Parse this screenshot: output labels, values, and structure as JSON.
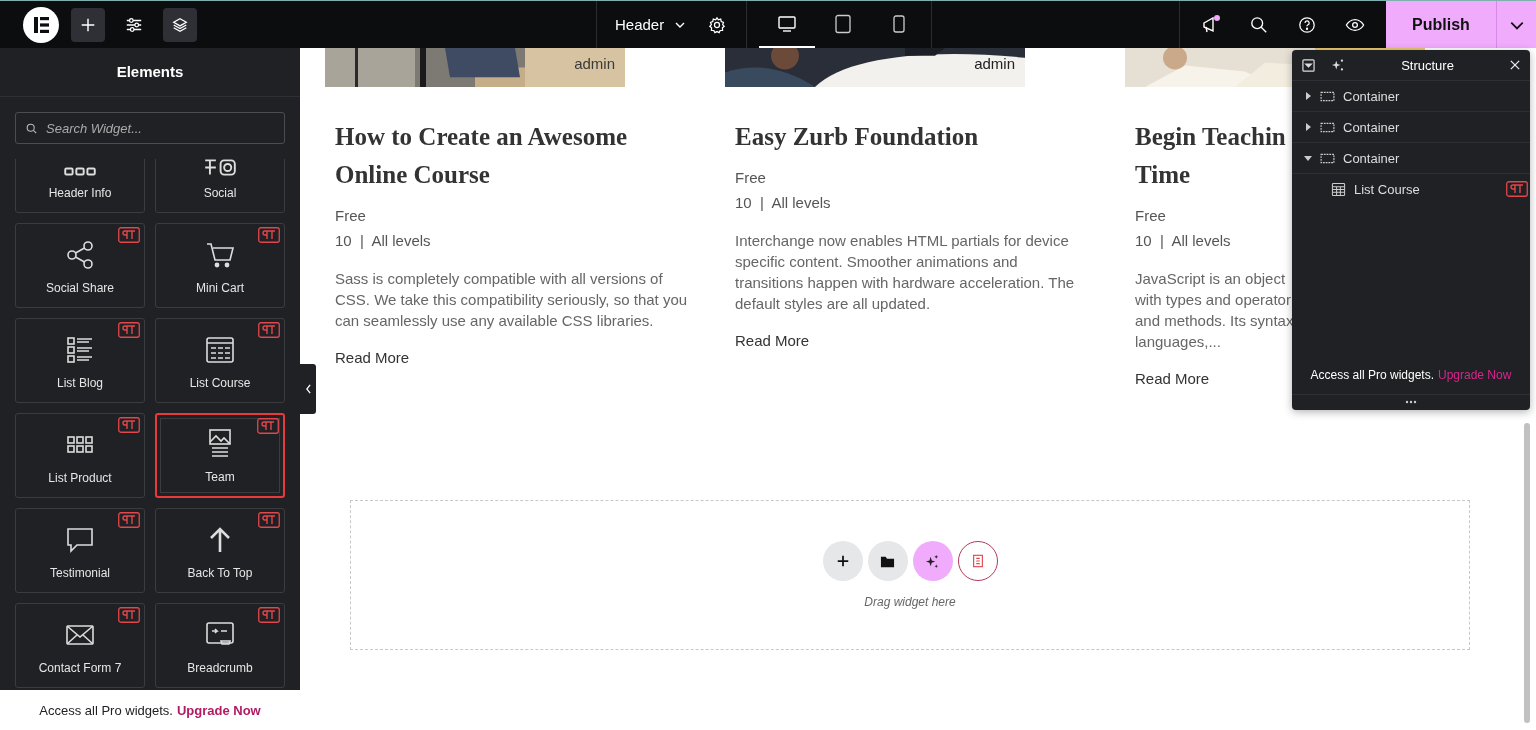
{
  "topbar": {
    "page_menu": "Header",
    "devices": [
      {
        "kind": "desktop",
        "selected": true
      },
      {
        "kind": "tablet",
        "selected": false
      },
      {
        "kind": "mobile",
        "selected": false
      }
    ],
    "notification": true,
    "publish": "Publish"
  },
  "panel": {
    "title": "Elements",
    "search": {
      "placeholder": "Search Widget..."
    },
    "widgets": [
      {
        "label": "Header Info",
        "selected": false
      },
      {
        "label": "Social",
        "selected": false
      },
      {
        "label": "Social Share",
        "pro": true,
        "selected": false
      },
      {
        "label": "Mini Cart",
        "pro": true,
        "selected": false
      },
      {
        "label": "List Blog",
        "pro": true,
        "selected": false
      },
      {
        "label": "List Course",
        "pro": true,
        "selected": false
      },
      {
        "label": "List Product",
        "pro": true,
        "selected": false
      },
      {
        "label": "Team",
        "pro": true,
        "selected": true
      },
      {
        "label": "Testimonial",
        "pro": true,
        "selected": false
      },
      {
        "label": "Back To Top",
        "pro": true,
        "selected": false
      },
      {
        "label": "Contact Form 7",
        "pro": true,
        "selected": false
      },
      {
        "label": "Breadcrumb",
        "pro": true,
        "selected": false
      }
    ],
    "promo": {
      "text": "Access all Pro widgets.",
      "link": "Upgrade Now"
    }
  },
  "courses": [
    {
      "image_caption": "admin",
      "title_lines": [
        "How to Create an Awesome",
        "Online Course"
      ],
      "price": "Free",
      "meta": "10  |  All levels",
      "desc_lines": [
        "Sass is completely compatible with all versions of",
        "CSS. We take this compatibility seriously, so that you",
        "can seamlessly use any available CSS libraries."
      ],
      "link": "Read More"
    },
    {
      "image_caption": "admin",
      "title_lines": [
        "Easy Zurb Foundation"
      ],
      "price": "Free",
      "meta": "10  |  All levels",
      "desc_lines": [
        "Interchange now enables HTML partials for device",
        "specific content. Smoother animations and",
        "transitions happen with hardware acceleration. The",
        "default styles are all updated."
      ],
      "link": "Read More"
    },
    {
      "title_lines": [
        "Begin Teachin",
        "Time"
      ],
      "price": "Free",
      "meta": "10  |  All levels",
      "desc_lines": [
        "JavaScript is an object",
        "with types and operator",
        "and methods. Its syntax",
        "languages,..."
      ],
      "link": "Read More"
    }
  ],
  "dropzone": {
    "hint": "Drag widget here"
  },
  "structure": {
    "title": "Structure",
    "tree": [
      {
        "label": "Container",
        "expanded": false
      },
      {
        "label": "Container",
        "expanded": false
      },
      {
        "label": "Container",
        "expanded": true,
        "children": [
          {
            "label": "List Course",
            "pro": true
          }
        ]
      }
    ],
    "promo": {
      "text": "Access all Pro widgets.",
      "link": "Upgrade Now"
    }
  }
}
